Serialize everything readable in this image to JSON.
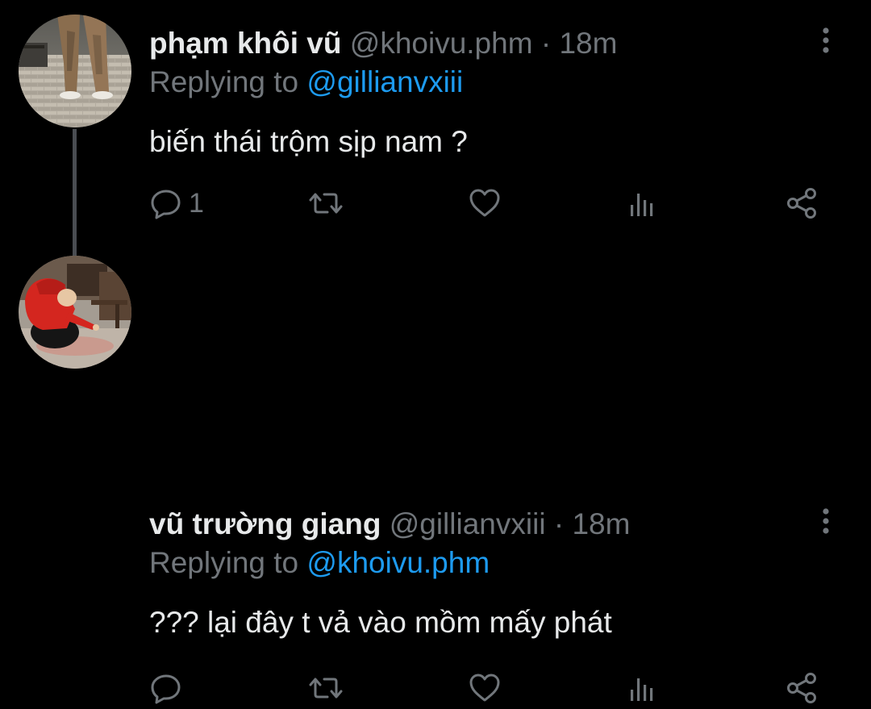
{
  "tweets": [
    {
      "name": "phạm khôi vũ",
      "handle": "@khoivu.phm",
      "separator": "·",
      "time": "18m",
      "replying_prefix": "Replying to ",
      "replying_to": "@gillianvxiii",
      "text": "biến thái trộm sịp nam ?",
      "reply_count": "1"
    },
    {
      "name": "vũ trường giang",
      "handle": "@gillianvxiii",
      "separator": "·",
      "time": "18m",
      "replying_prefix": "Replying to ",
      "replying_to": "@khoivu.phm",
      "text": "??? lại đây t vả vào mồm mấy phát",
      "reply_count": ""
    }
  ],
  "icons": {
    "reply": "reply-icon",
    "retweet": "retweet-icon",
    "like": "heart-icon",
    "views": "views-icon",
    "share": "share-icon",
    "more": "more-vertical-icon"
  },
  "colors": {
    "background": "#000000",
    "text": "#e7e9ea",
    "muted": "#71767b",
    "accent": "#1d9bf0",
    "thread_line": "#4a4d52"
  }
}
